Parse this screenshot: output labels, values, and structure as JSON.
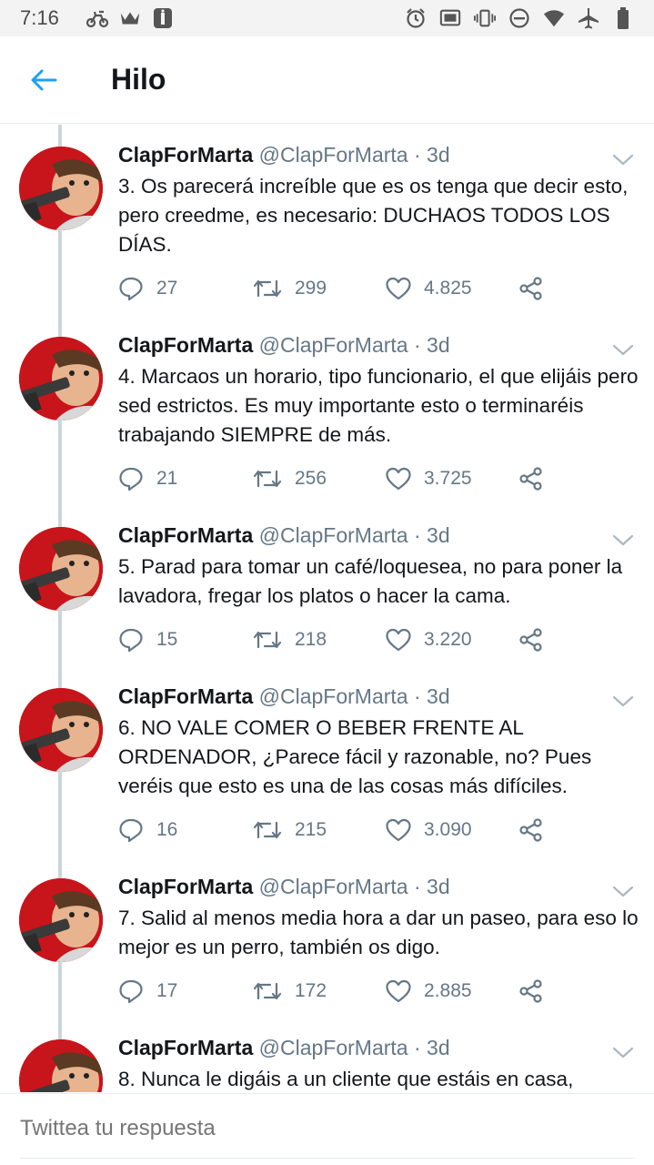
{
  "status_bar": {
    "time": "7:16"
  },
  "header": {
    "title": "Hilo"
  },
  "tweets": [
    {
      "name": "ClapForMarta",
      "handle": "@ClapForMarta",
      "dot": "·",
      "age": "3d",
      "text": "3. Os parecerá increíble que es os tenga que decir esto, pero creedme, es necesario: DUCHAOS TODOS LOS DÍAS.",
      "replies": "27",
      "retweets": "299",
      "likes": "4.825"
    },
    {
      "name": "ClapForMarta",
      "handle": "@ClapForMarta",
      "dot": "·",
      "age": "3d",
      "text": "4. Marcaos un horario, tipo funcionario, el que elijáis pero sed estrictos. Es muy importante esto o terminaréis trabajando SIEMPRE de más.",
      "replies": "21",
      "retweets": "256",
      "likes": "3.725"
    },
    {
      "name": "ClapForMarta",
      "handle": "@ClapForMarta",
      "dot": "·",
      "age": "3d",
      "text": "5. Parad para tomar un café/loquesea, no para poner la lavadora, fregar los platos o hacer la cama.",
      "replies": "15",
      "retweets": "218",
      "likes": "3.220"
    },
    {
      "name": "ClapForMarta",
      "handle": "@ClapForMarta",
      "dot": "·",
      "age": "3d",
      "text": "6. NO VALE COMER O BEBER FRENTE AL ORDENADOR, ¿Parece fácil y razonable, no? Pues veréis que esto es una de las cosas más difíciles.",
      "replies": "16",
      "retweets": "215",
      "likes": "3.090"
    },
    {
      "name": "ClapForMarta",
      "handle": "@ClapForMarta",
      "dot": "·",
      "age": "3d",
      "text": "7. Salid al menos media hora a dar un paseo, para eso lo mejor es un perro, también os digo.",
      "replies": "17",
      "retweets": "172",
      "likes": "2.885"
    },
    {
      "name": "ClapForMarta",
      "handle": "@ClapForMarta",
      "dot": "·",
      "age": "3d",
      "text": "8. Nunca le digáis a un cliente que estáis en casa,",
      "replies": "",
      "retweets": "",
      "likes": ""
    }
  ],
  "reply_bar": {
    "placeholder": "Twittea tu respuesta"
  },
  "colors": {
    "accent": "#1da1f2",
    "text": "#14171a",
    "secondary": "#657786",
    "rail": "#ccd6dd",
    "avatar_bg": "#c8141b"
  },
  "icons": [
    "back-arrow-icon",
    "reply-icon",
    "retweet-icon",
    "like-icon",
    "share-icon",
    "caret-down-icon",
    "alarm-icon",
    "cast-icon",
    "vibrate-icon",
    "dnd-icon",
    "wifi-icon",
    "airplane-icon",
    "battery-icon"
  ]
}
